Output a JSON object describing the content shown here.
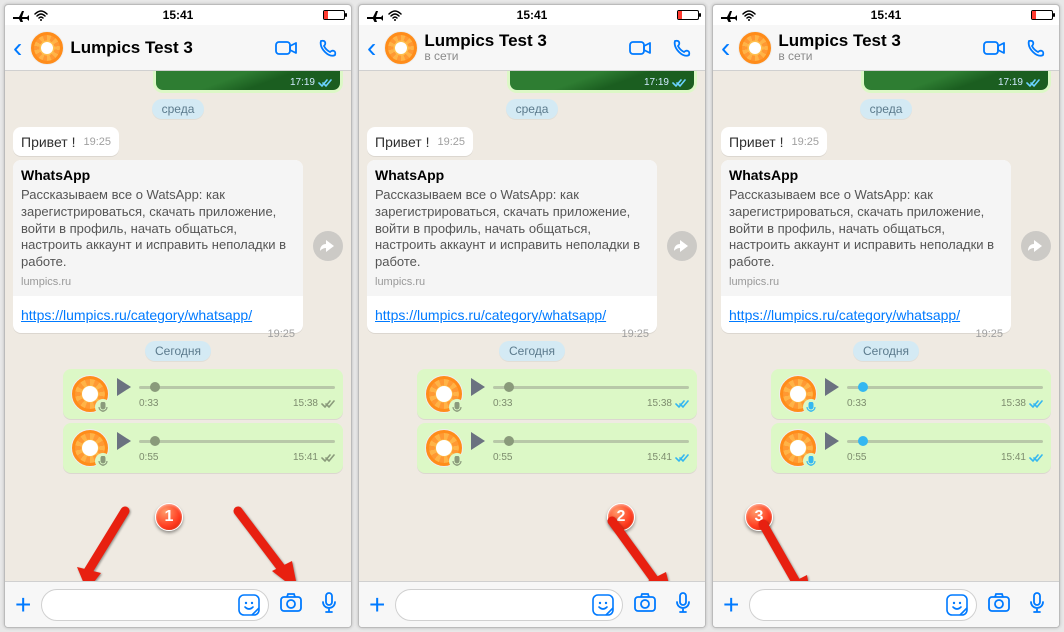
{
  "statusbar": {
    "time": "15:41"
  },
  "header": {
    "name": "Lumpics Test 3",
    "panel2_sub": "в сети",
    "panel3_sub": "в сети"
  },
  "img_tail": {
    "time": "17:19"
  },
  "date_chips": {
    "wednesday": "среда",
    "today": "Сегодня"
  },
  "greeting": {
    "text": "Привет !",
    "time": "19:25"
  },
  "linkmsg": {
    "title": "WhatsApp",
    "desc": "Рассказываем все о WatsApp: как зарегистрироваться, скачать приложение, войти в профиль, начать общаться, настроить аккаунт и исправить неполадки в работе.",
    "domain": "lumpics.ru",
    "link": "https://lumpics.ru/category/whatsapp/",
    "time": "19:25"
  },
  "voice": {
    "p1": {
      "v1": {
        "dur": "0:33",
        "time": "15:38",
        "dot_pos": "8%",
        "dot_class": "gray",
        "mic": "gray",
        "ticks": "gray"
      },
      "v2": {
        "dur": "0:55",
        "time": "15:41",
        "dot_pos": "8%",
        "dot_class": "gray",
        "mic": "gray",
        "ticks": "gray"
      }
    },
    "p2": {
      "v1": {
        "dur": "0:33",
        "time": "15:38",
        "dot_pos": "8%",
        "dot_class": "gray",
        "mic": "gray",
        "ticks": "blue"
      },
      "v2": {
        "dur": "0:55",
        "time": "15:41",
        "dot_pos": "8%",
        "dot_class": "gray",
        "mic": "gray",
        "ticks": "blue"
      }
    },
    "p3": {
      "v1": {
        "dur": "0:33",
        "time": "15:38",
        "dot_pos": "8%",
        "dot_class": "blue",
        "mic": "blue",
        "ticks": "blue"
      },
      "v2": {
        "dur": "0:55",
        "time": "15:41",
        "dot_pos": "8%",
        "dot_class": "blue",
        "mic": "blue",
        "ticks": "blue"
      }
    }
  },
  "steps": {
    "s1": "1",
    "s2": "2",
    "s3": "3"
  }
}
